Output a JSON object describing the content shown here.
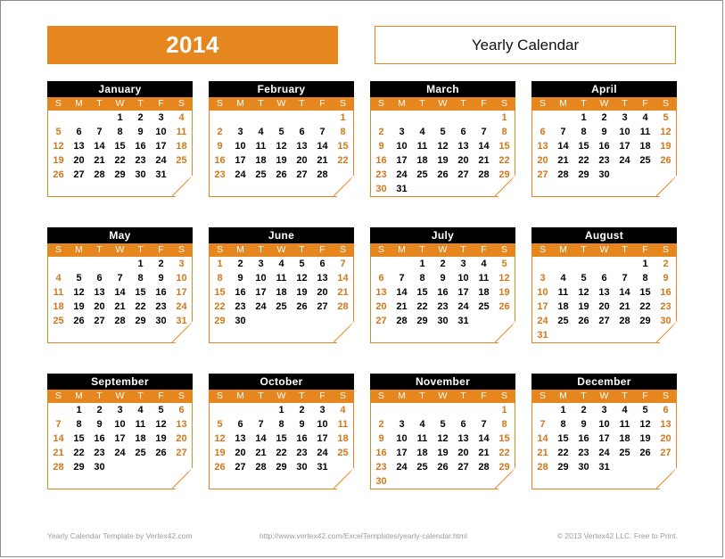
{
  "header": {
    "year": "2014",
    "title": "Yearly Calendar"
  },
  "colors": {
    "accent_orange": "#E6861F",
    "weekend_text": "#D2771A",
    "month_header_bg": "#000000",
    "page_border": "#8d8a92",
    "footer_text": "#9a9aa6"
  },
  "weekday_headers": [
    "S",
    "M",
    "T",
    "W",
    "T",
    "F",
    "S"
  ],
  "months": [
    {
      "name": "January",
      "first_weekday": 3,
      "days": 31,
      "weeks": [
        [
          "",
          "",
          "",
          "1",
          "2",
          "3",
          "4"
        ],
        [
          "5",
          "6",
          "7",
          "8",
          "9",
          "10",
          "11"
        ],
        [
          "12",
          "13",
          "14",
          "15",
          "16",
          "17",
          "18"
        ],
        [
          "19",
          "20",
          "21",
          "22",
          "23",
          "24",
          "25"
        ],
        [
          "26",
          "27",
          "28",
          "29",
          "30",
          "31",
          ""
        ],
        [
          "",
          "",
          "",
          "",
          "",
          "",
          ""
        ]
      ]
    },
    {
      "name": "February",
      "first_weekday": 6,
      "days": 28,
      "weeks": [
        [
          "",
          "",
          "",
          "",
          "",
          "",
          "1"
        ],
        [
          "2",
          "3",
          "4",
          "5",
          "6",
          "7",
          "8"
        ],
        [
          "9",
          "10",
          "11",
          "12",
          "13",
          "14",
          "15"
        ],
        [
          "16",
          "17",
          "18",
          "19",
          "20",
          "21",
          "22"
        ],
        [
          "23",
          "24",
          "25",
          "26",
          "27",
          "28",
          ""
        ],
        [
          "",
          "",
          "",
          "",
          "",
          "",
          ""
        ]
      ]
    },
    {
      "name": "March",
      "first_weekday": 6,
      "days": 31,
      "weeks": [
        [
          "",
          "",
          "",
          "",
          "",
          "",
          "1"
        ],
        [
          "2",
          "3",
          "4",
          "5",
          "6",
          "7",
          "8"
        ],
        [
          "9",
          "10",
          "11",
          "12",
          "13",
          "14",
          "15"
        ],
        [
          "16",
          "17",
          "18",
          "19",
          "20",
          "21",
          "22"
        ],
        [
          "23",
          "24",
          "25",
          "26",
          "27",
          "28",
          "29"
        ],
        [
          "30",
          "31",
          "",
          "",
          "",
          "",
          ""
        ]
      ]
    },
    {
      "name": "April",
      "first_weekday": 2,
      "days": 30,
      "weeks": [
        [
          "",
          "",
          "1",
          "2",
          "3",
          "4",
          "5"
        ],
        [
          "6",
          "7",
          "8",
          "9",
          "10",
          "11",
          "12"
        ],
        [
          "13",
          "14",
          "15",
          "16",
          "17",
          "18",
          "19"
        ],
        [
          "20",
          "21",
          "22",
          "23",
          "24",
          "25",
          "26"
        ],
        [
          "27",
          "28",
          "29",
          "30",
          "",
          "",
          ""
        ],
        [
          "",
          "",
          "",
          "",
          "",
          "",
          ""
        ]
      ]
    },
    {
      "name": "May",
      "first_weekday": 4,
      "days": 31,
      "weeks": [
        [
          "",
          "",
          "",
          "",
          "1",
          "2",
          "3"
        ],
        [
          "4",
          "5",
          "6",
          "7",
          "8",
          "9",
          "10"
        ],
        [
          "11",
          "12",
          "13",
          "14",
          "15",
          "16",
          "17"
        ],
        [
          "18",
          "19",
          "20",
          "21",
          "22",
          "23",
          "24"
        ],
        [
          "25",
          "26",
          "27",
          "28",
          "29",
          "30",
          "31"
        ],
        [
          "",
          "",
          "",
          "",
          "",
          "",
          ""
        ]
      ]
    },
    {
      "name": "June",
      "first_weekday": 0,
      "days": 30,
      "weeks": [
        [
          "1",
          "2",
          "3",
          "4",
          "5",
          "6",
          "7"
        ],
        [
          "8",
          "9",
          "10",
          "11",
          "12",
          "13",
          "14"
        ],
        [
          "15",
          "16",
          "17",
          "18",
          "19",
          "20",
          "21"
        ],
        [
          "22",
          "23",
          "24",
          "25",
          "26",
          "27",
          "28"
        ],
        [
          "29",
          "30",
          "",
          "",
          "",
          "",
          ""
        ],
        [
          "",
          "",
          "",
          "",
          "",
          "",
          ""
        ]
      ]
    },
    {
      "name": "July",
      "first_weekday": 2,
      "days": 31,
      "weeks": [
        [
          "",
          "",
          "1",
          "2",
          "3",
          "4",
          "5"
        ],
        [
          "6",
          "7",
          "8",
          "9",
          "10",
          "11",
          "12"
        ],
        [
          "13",
          "14",
          "15",
          "16",
          "17",
          "18",
          "19"
        ],
        [
          "20",
          "21",
          "22",
          "23",
          "24",
          "25",
          "26"
        ],
        [
          "27",
          "28",
          "29",
          "30",
          "31",
          "",
          ""
        ],
        [
          "",
          "",
          "",
          "",
          "",
          "",
          ""
        ]
      ]
    },
    {
      "name": "August",
      "first_weekday": 5,
      "days": 31,
      "weeks": [
        [
          "",
          "",
          "",
          "",
          "",
          "1",
          "2"
        ],
        [
          "3",
          "4",
          "5",
          "6",
          "7",
          "8",
          "9"
        ],
        [
          "10",
          "11",
          "12",
          "13",
          "14",
          "15",
          "16"
        ],
        [
          "17",
          "18",
          "19",
          "20",
          "21",
          "22",
          "23"
        ],
        [
          "24",
          "25",
          "26",
          "27",
          "28",
          "29",
          "30"
        ],
        [
          "31",
          "",
          "",
          "",
          "",
          "",
          ""
        ]
      ]
    },
    {
      "name": "September",
      "first_weekday": 1,
      "days": 30,
      "weeks": [
        [
          "",
          "1",
          "2",
          "3",
          "4",
          "5",
          "6"
        ],
        [
          "7",
          "8",
          "9",
          "10",
          "11",
          "12",
          "13"
        ],
        [
          "14",
          "15",
          "16",
          "17",
          "18",
          "19",
          "20"
        ],
        [
          "21",
          "22",
          "23",
          "24",
          "25",
          "26",
          "27"
        ],
        [
          "28",
          "29",
          "30",
          "",
          "",
          "",
          ""
        ],
        [
          "",
          "",
          "",
          "",
          "",
          "",
          ""
        ]
      ]
    },
    {
      "name": "October",
      "first_weekday": 3,
      "days": 31,
      "weeks": [
        [
          "",
          "",
          "",
          "1",
          "2",
          "3",
          "4"
        ],
        [
          "5",
          "6",
          "7",
          "8",
          "9",
          "10",
          "11"
        ],
        [
          "12",
          "13",
          "14",
          "15",
          "16",
          "17",
          "18"
        ],
        [
          "19",
          "20",
          "21",
          "22",
          "23",
          "24",
          "25"
        ],
        [
          "26",
          "27",
          "28",
          "29",
          "30",
          "31",
          ""
        ],
        [
          "",
          "",
          "",
          "",
          "",
          "",
          ""
        ]
      ]
    },
    {
      "name": "November",
      "first_weekday": 6,
      "days": 30,
      "weeks": [
        [
          "",
          "",
          "",
          "",
          "",
          "",
          "1"
        ],
        [
          "2",
          "3",
          "4",
          "5",
          "6",
          "7",
          "8"
        ],
        [
          "9",
          "10",
          "11",
          "12",
          "13",
          "14",
          "15"
        ],
        [
          "16",
          "17",
          "18",
          "19",
          "20",
          "21",
          "22"
        ],
        [
          "23",
          "24",
          "25",
          "26",
          "27",
          "28",
          "29"
        ],
        [
          "30",
          "",
          "",
          "",
          "",
          "",
          ""
        ]
      ]
    },
    {
      "name": "December",
      "first_weekday": 1,
      "days": 31,
      "weeks": [
        [
          "",
          "1",
          "2",
          "3",
          "4",
          "5",
          "6"
        ],
        [
          "7",
          "8",
          "9",
          "10",
          "11",
          "12",
          "13"
        ],
        [
          "14",
          "15",
          "16",
          "17",
          "18",
          "19",
          "20"
        ],
        [
          "21",
          "22",
          "23",
          "24",
          "25",
          "26",
          "27"
        ],
        [
          "28",
          "29",
          "30",
          "31",
          "",
          "",
          ""
        ],
        [
          "",
          "",
          "",
          "",
          "",
          "",
          ""
        ]
      ]
    }
  ],
  "footer": {
    "left": "Yearly Calendar Template by Vertex42.com",
    "center": "http://www.vertex42.com/ExcelTemplates/yearly-calendar.html",
    "right": "© 2013 Vertex42 LLC. Free to Print."
  }
}
